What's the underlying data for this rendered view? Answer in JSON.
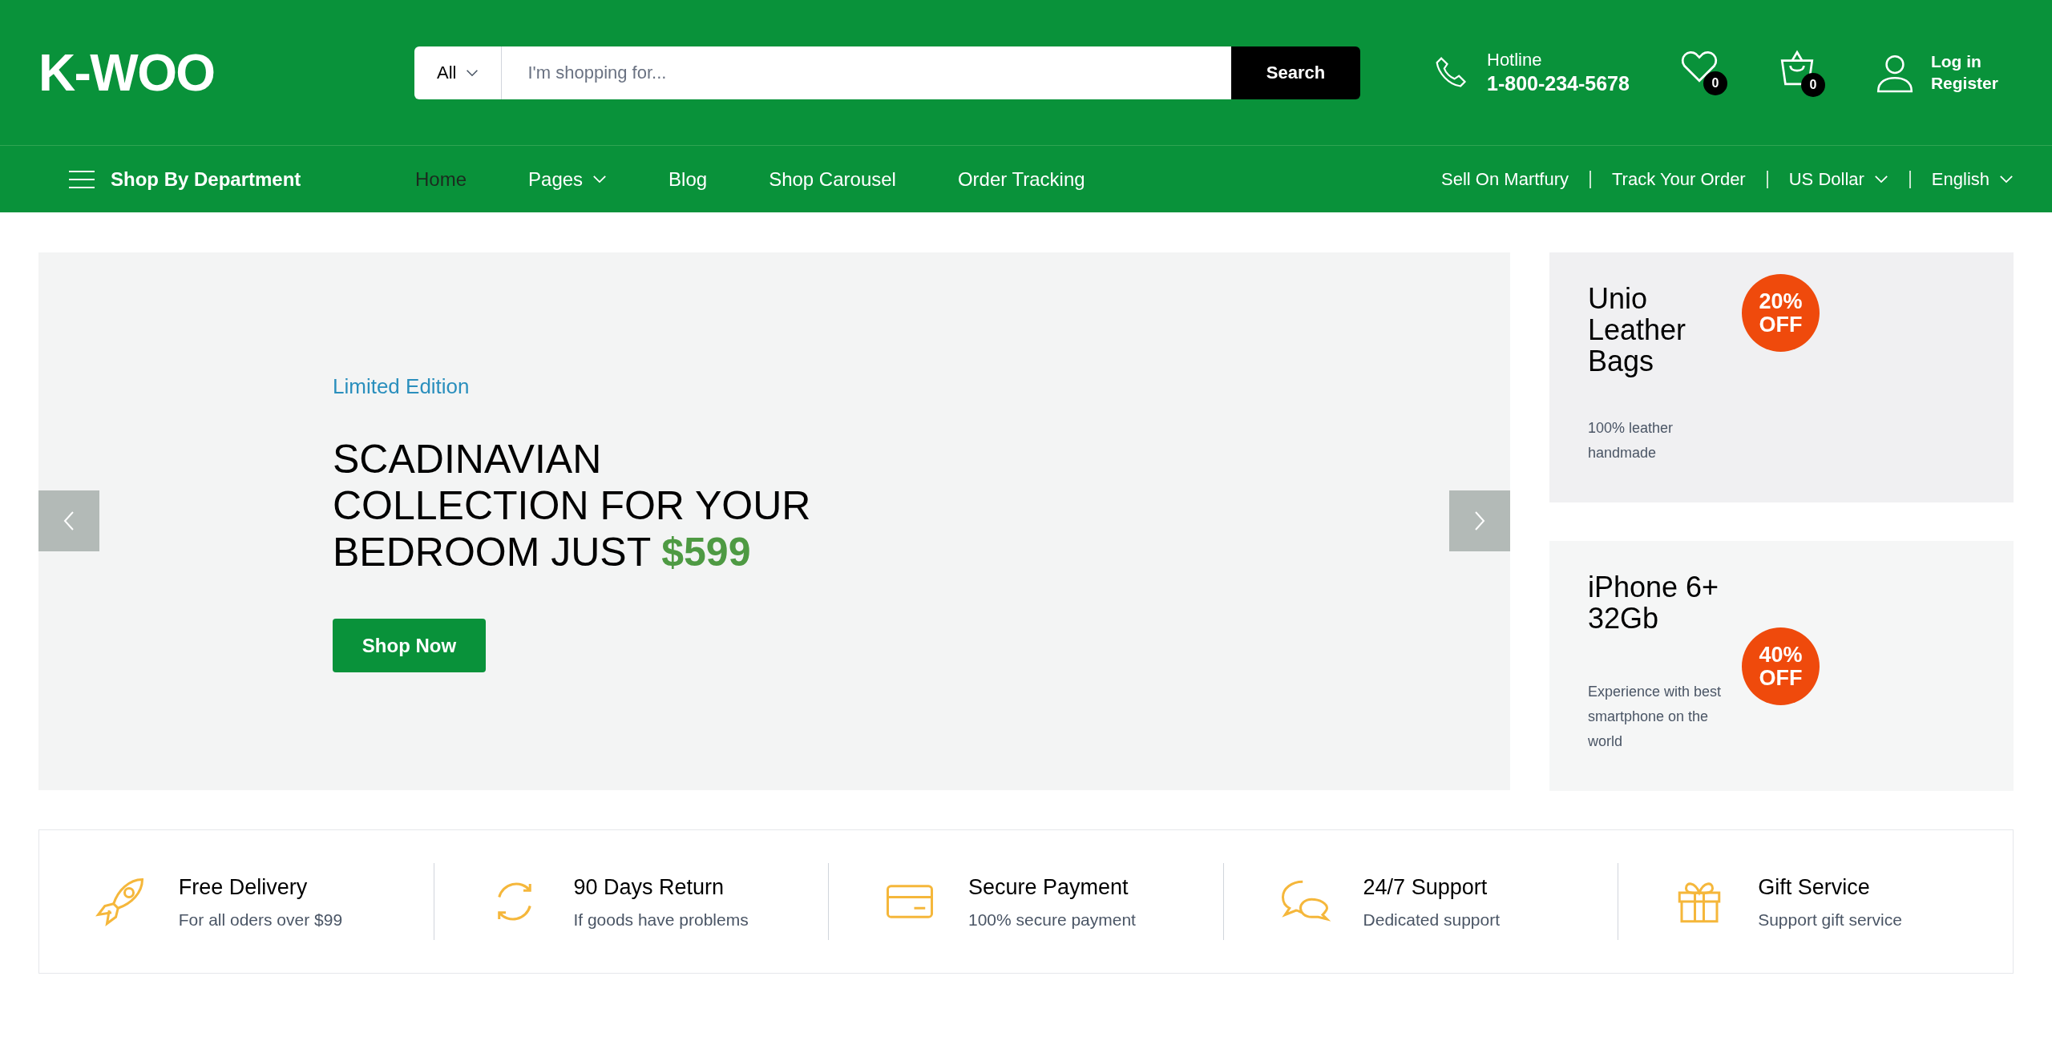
{
  "header": {
    "logo": "K-WOO",
    "search": {
      "category": "All",
      "placeholder": "I'm shopping for...",
      "button": "Search"
    },
    "hotline": {
      "label": "Hotline",
      "number": "1-800-234-5678"
    },
    "wishlist_count": "0",
    "cart_count": "0",
    "account": [
      "Log in",
      "Register"
    ]
  },
  "nav": {
    "department": "Shop By Department",
    "items": [
      {
        "label": "Home",
        "selected": true,
        "dropdown": false
      },
      {
        "label": "Pages",
        "selected": false,
        "dropdown": true
      },
      {
        "label": "Blog",
        "selected": false,
        "dropdown": false
      },
      {
        "label": "Shop Carousel",
        "selected": false,
        "dropdown": false
      },
      {
        "label": "Order Tracking",
        "selected": false,
        "dropdown": false
      }
    ],
    "right_items": [
      {
        "label": "Sell On Martfury",
        "dropdown": false
      },
      {
        "label": "Track Your Order",
        "dropdown": false
      },
      {
        "label": "US Dollar",
        "dropdown": true
      },
      {
        "label": "English",
        "dropdown": true
      }
    ]
  },
  "hero": {
    "eyebrow": "Limited Edition",
    "title": "SCADINAVIAN COLLECTION FOR YOUR BEDROOM JUST",
    "price": "$599",
    "button": "Shop Now"
  },
  "promos": [
    {
      "title": "Unio Leather Bags",
      "badge": [
        "20%",
        "OFF"
      ],
      "description": "100% leather handmade"
    },
    {
      "title": "iPhone 6+ 32Gb",
      "badge": [
        "40%",
        "OFF"
      ],
      "description": "Experience with best smartphone on the world"
    }
  ],
  "features": [
    {
      "kind": "rocket",
      "title": "Free Delivery",
      "subtitle": "For all oders over $99"
    },
    {
      "kind": "refresh",
      "title": "90 Days Return",
      "subtitle": "If goods have problems"
    },
    {
      "kind": "card",
      "title": "Secure Payment",
      "subtitle": "100% secure payment"
    },
    {
      "kind": "chat",
      "title": "24/7 Support",
      "subtitle": "Dedicated support"
    },
    {
      "kind": "gift",
      "title": "Gift Service",
      "subtitle": "Support gift service"
    }
  ]
}
